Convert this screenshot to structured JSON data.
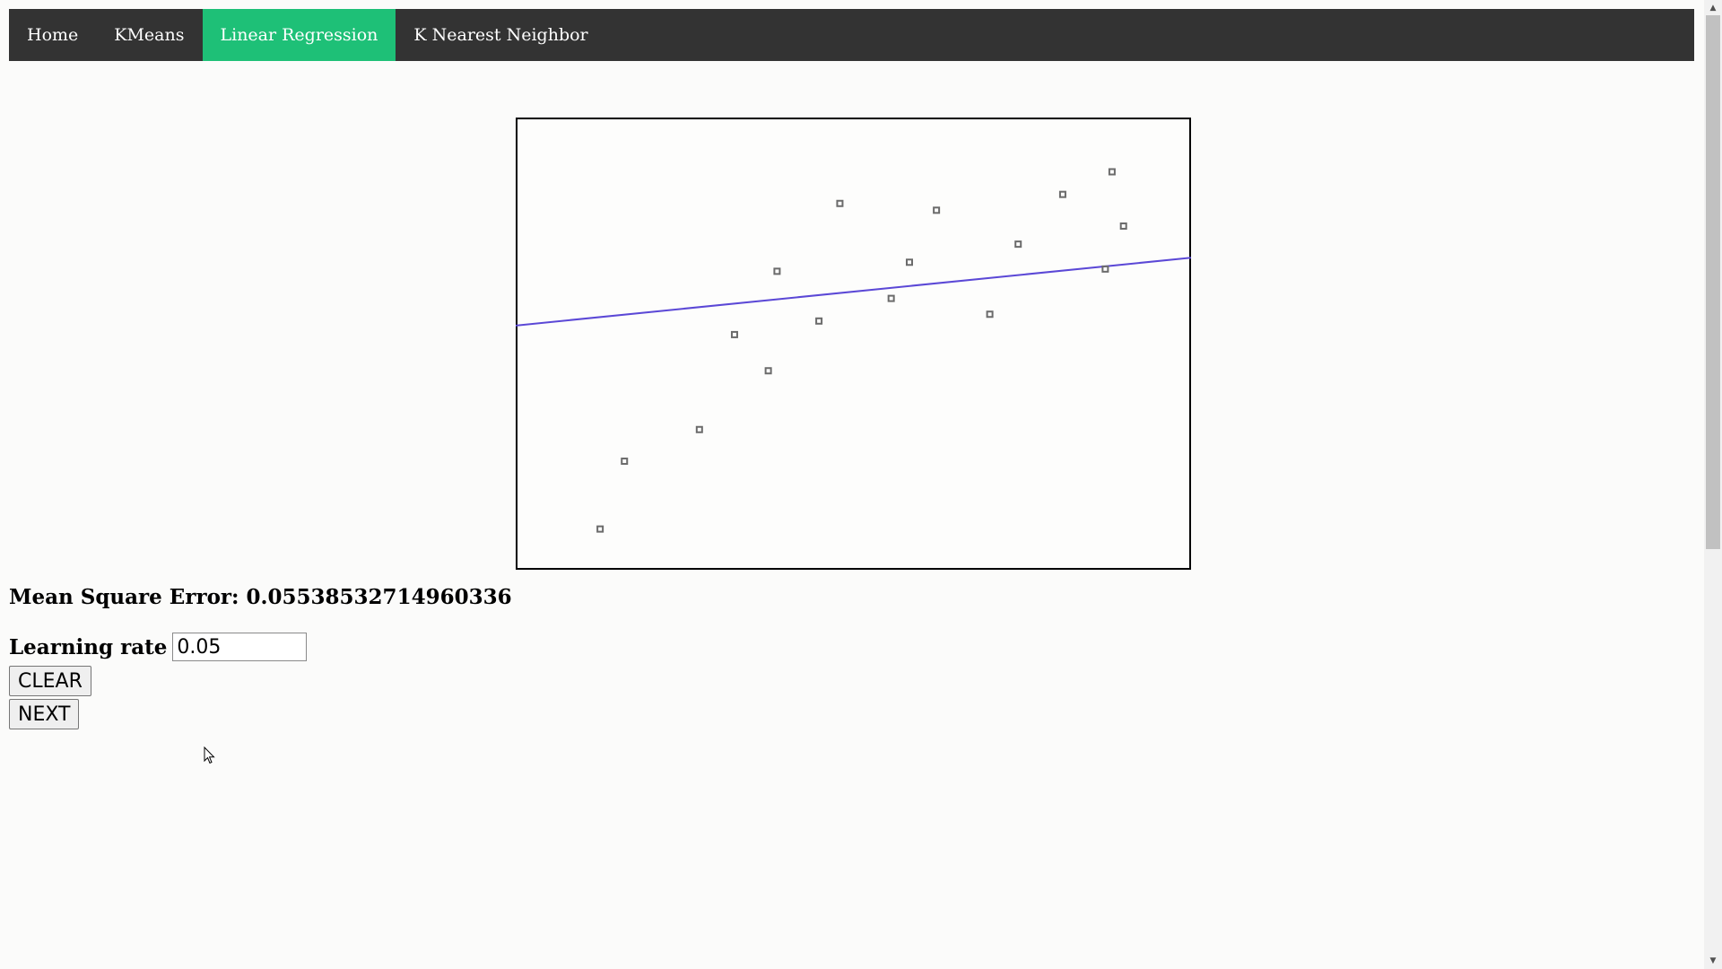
{
  "nav": {
    "items": [
      {
        "label": "Home"
      },
      {
        "label": "KMeans"
      },
      {
        "label": "Linear Regression",
        "active": true
      },
      {
        "label": "K Nearest Neighbor"
      }
    ],
    "bg_color": "#333333",
    "active_color": "#1ec077"
  },
  "plot": {
    "line_color": "#5b48d6",
    "point_color": "#6b6b6b"
  },
  "chart_data": {
    "type": "scatter",
    "title": "",
    "xlabel": "",
    "ylabel": "",
    "xlim": [
      0,
      1
    ],
    "ylim": [
      0,
      1
    ],
    "points": [
      {
        "x": 0.125,
        "y": 0.09
      },
      {
        "x": 0.161,
        "y": 0.24
      },
      {
        "x": 0.272,
        "y": 0.31
      },
      {
        "x": 0.324,
        "y": 0.52
      },
      {
        "x": 0.374,
        "y": 0.44
      },
      {
        "x": 0.387,
        "y": 0.66
      },
      {
        "x": 0.449,
        "y": 0.55
      },
      {
        "x": 0.48,
        "y": 0.81
      },
      {
        "x": 0.556,
        "y": 0.6
      },
      {
        "x": 0.583,
        "y": 0.68
      },
      {
        "x": 0.623,
        "y": 0.795
      },
      {
        "x": 0.702,
        "y": 0.565
      },
      {
        "x": 0.744,
        "y": 0.72
      },
      {
        "x": 0.81,
        "y": 0.83
      },
      {
        "x": 0.873,
        "y": 0.665
      },
      {
        "x": 0.883,
        "y": 0.88
      },
      {
        "x": 0.9,
        "y": 0.76
      }
    ],
    "regression_line": {
      "y_at_x0": 0.54,
      "y_at_x1": 0.69
    }
  },
  "results": {
    "mse_text": "Mean Square Error: 0.05538532714960336"
  },
  "controls": {
    "learning_rate_label": "Learning rate",
    "learning_rate_value": "0.05",
    "clear_label": "CLEAR",
    "next_label": "NEXT"
  }
}
